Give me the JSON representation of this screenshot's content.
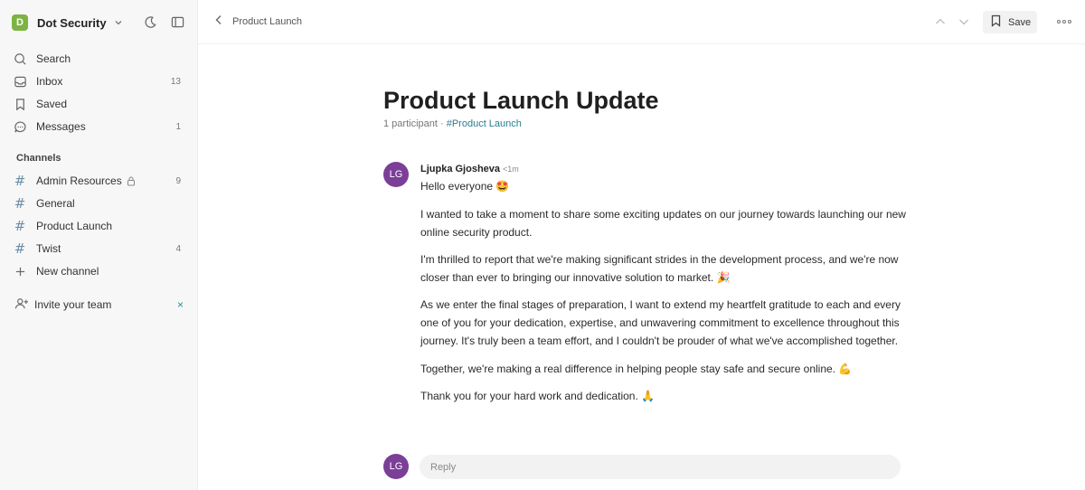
{
  "workspace": {
    "initial": "D",
    "name": "Dot Security"
  },
  "nav": {
    "search": "Search",
    "inbox": {
      "label": "Inbox",
      "count": "13"
    },
    "saved": "Saved",
    "messages": {
      "label": "Messages",
      "count": "1"
    }
  },
  "channels": {
    "title": "Channels",
    "items": [
      {
        "label": "Admin Resources",
        "count": "9",
        "locked": true
      },
      {
        "label": "General",
        "count": ""
      },
      {
        "label": "Product Launch",
        "count": ""
      },
      {
        "label": "Twist",
        "count": "4"
      }
    ],
    "new_channel": "New channel"
  },
  "invite": {
    "label": "Invite your team",
    "close": "×"
  },
  "topbar": {
    "breadcrumb": "Product Launch",
    "save_label": "Save"
  },
  "thread": {
    "title": "Product Launch Update",
    "participants": "1 participant",
    "separator": " · ",
    "channel": "#Product Launch"
  },
  "message": {
    "avatar": "LG",
    "author": "Ljupka Gjosheva",
    "time": "<1m",
    "paragraphs": [
      "Hello everyone 🤩",
      "I wanted to take a moment to share some exciting updates on our journey towards launching our new online security product.",
      "I'm thrilled to report that we're making significant strides in the development process, and we're now closer than ever to bringing our innovative solution to market. 🎉",
      "As we enter the final stages of preparation, I want to extend my heartfelt gratitude to each and every one of you for your dedication, expertise, and unwavering commitment to excellence throughout this journey. It's truly been a team effort, and I couldn't be prouder of what we've accomplished together.",
      "Together, we're making a real difference in helping people stay safe and secure online. 💪",
      "Thank you for your hard work and dedication. 🙏"
    ]
  },
  "reply": {
    "avatar": "LG",
    "placeholder": "Reply"
  },
  "colors": {
    "accent": "#2b8c95",
    "avatar": "#7b3f98",
    "logo": "#7cb342"
  }
}
